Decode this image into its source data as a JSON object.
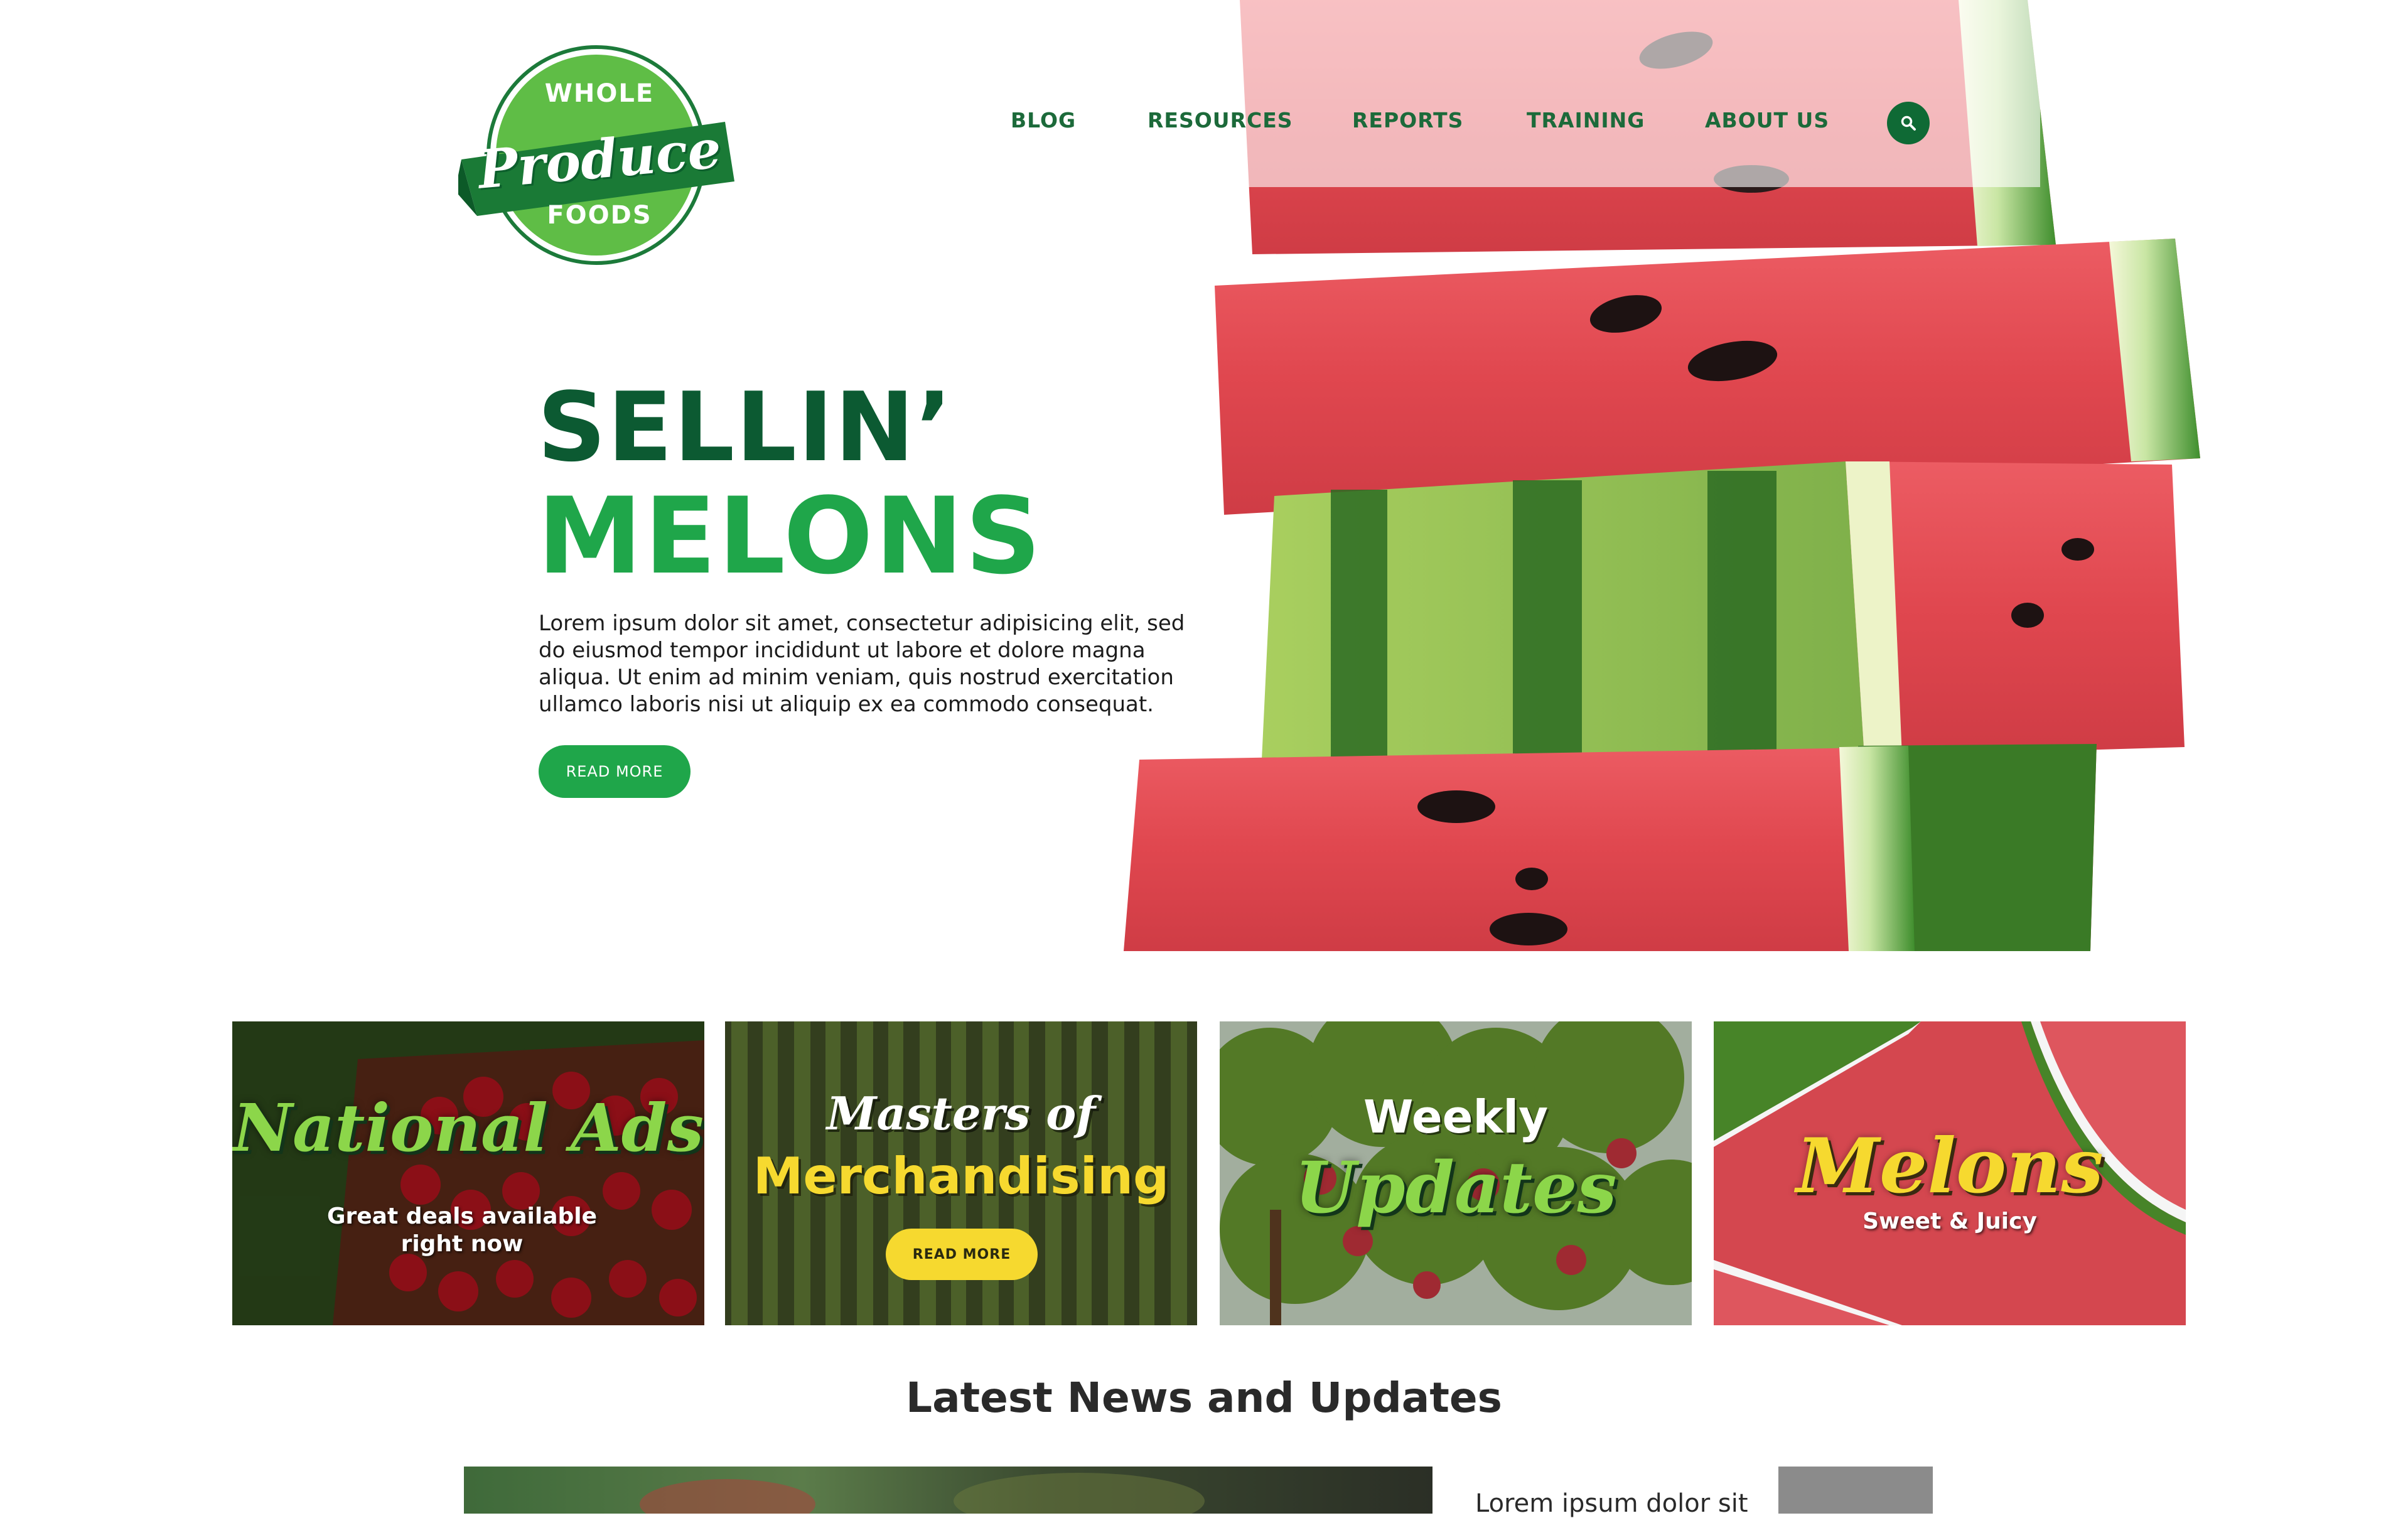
{
  "logo": {
    "line1": "WHOLE",
    "script": "Produce",
    "line2": "FOODS"
  },
  "nav": {
    "items": [
      {
        "label": "BLOG"
      },
      {
        "label": "RESOURCES"
      },
      {
        "label": "REPORTS"
      },
      {
        "label": "TRAINING"
      },
      {
        "label": "ABOUT US"
      }
    ],
    "search_icon": "search-icon"
  },
  "hero": {
    "line1": "SELLIN’",
    "line2": "MELONS",
    "paragraph": "Lorem ipsum dolor sit amet, consectetur adipisicing elit, sed do eiusmod tempor incididunt ut labore et dolore magna aliqua. Ut enim ad minim veniam, quis nostrud exercitation ullamco laboris nisi ut aliquip ex ea commodo consequat.",
    "button": "READ MORE"
  },
  "cards": [
    {
      "title": "National Ads",
      "subtitle_1": "Great deals available",
      "subtitle_2": "right now"
    },
    {
      "title_1": "Masters of",
      "title_2": "Merchandising",
      "button": "READ MORE"
    },
    {
      "title_1": "Weekly",
      "title_2": "Updates"
    },
    {
      "title": "Melons",
      "subtitle": "Sweet & Juicy"
    }
  ],
  "news": {
    "heading": "Latest News and Updates",
    "first_item_text": "Lorem ipsum dolor sit"
  },
  "colors": {
    "brand_dark_green": "#0c5a32",
    "brand_green": "#1fa64a",
    "nav_green": "#1c6a3a",
    "accent_yellow": "#f6d92f",
    "melon_red": "#e04b52"
  }
}
